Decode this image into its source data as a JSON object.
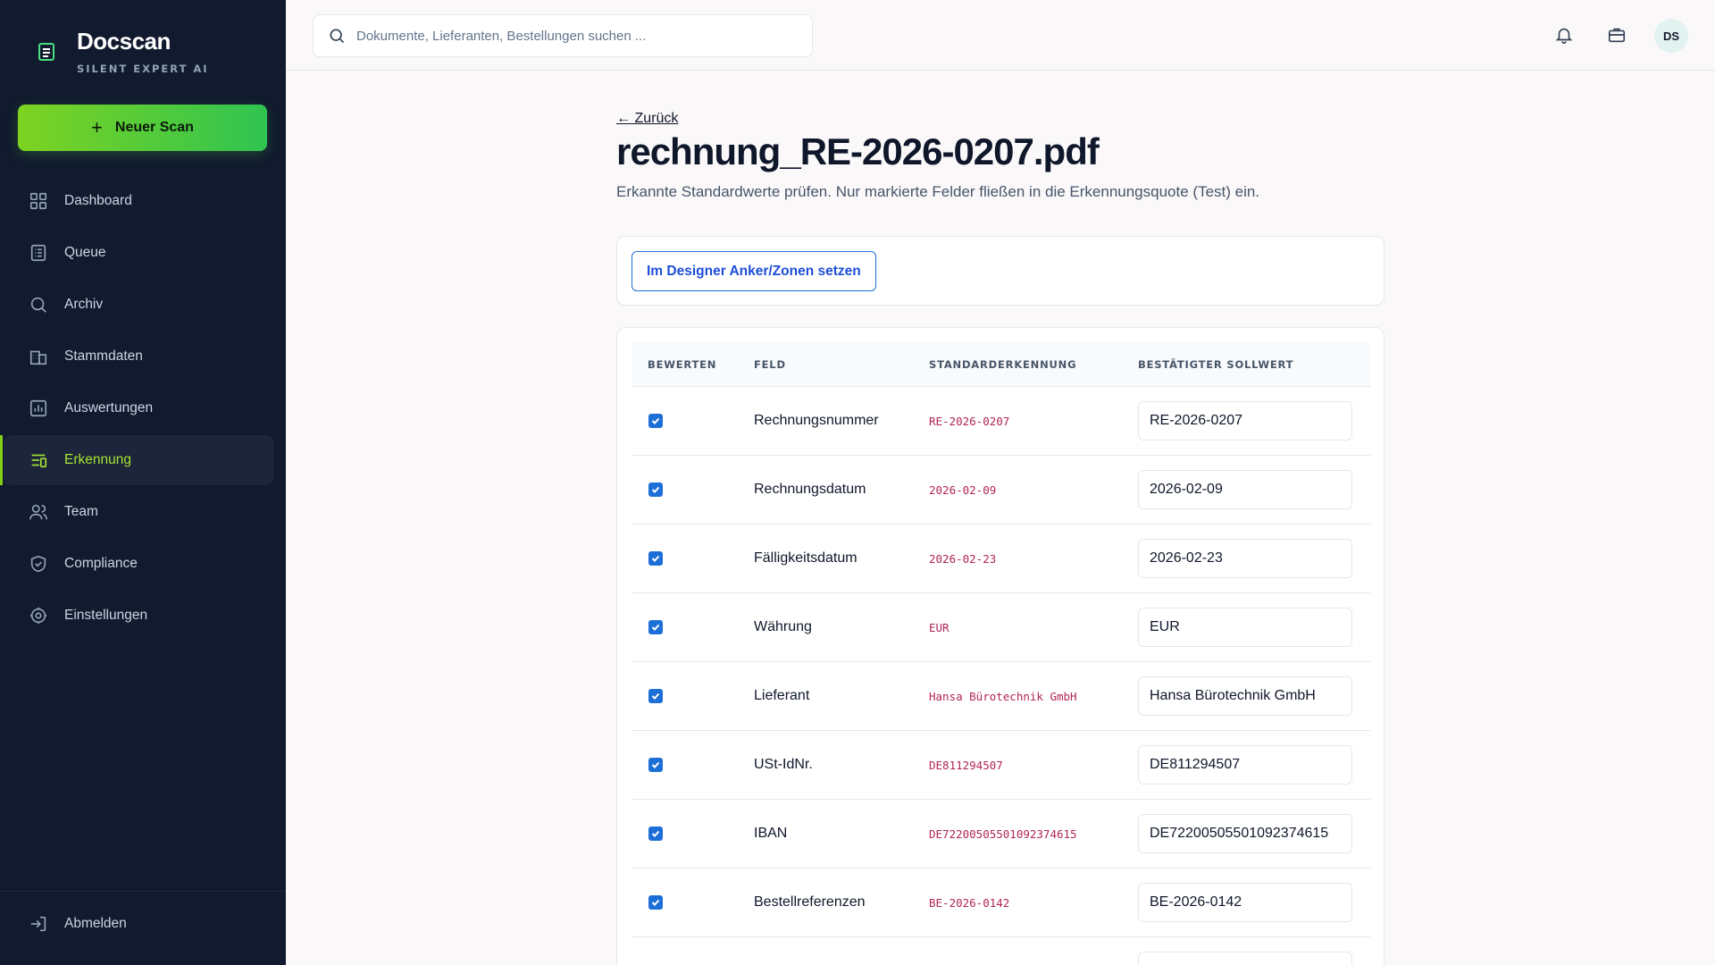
{
  "app": {
    "name": "Docscan",
    "tagline": "SILENT EXPERT AI",
    "new_scan_label": "Neuer Scan",
    "accent_color": "#84cc16"
  },
  "sidebar": {
    "items": [
      {
        "label": "Dashboard",
        "icon": "grid-icon",
        "active": false
      },
      {
        "label": "Queue",
        "icon": "list-icon",
        "active": false
      },
      {
        "label": "Archiv",
        "icon": "search-icon",
        "active": false
      },
      {
        "label": "Stammdaten",
        "icon": "building-icon",
        "active": false
      },
      {
        "label": "Auswertungen",
        "icon": "chart-icon",
        "active": false
      },
      {
        "label": "Erkennung",
        "icon": "filter-lines-icon",
        "active": true
      },
      {
        "label": "Team",
        "icon": "users-icon",
        "active": false
      },
      {
        "label": "Compliance",
        "icon": "shield-icon",
        "active": false
      },
      {
        "label": "Einstellungen",
        "icon": "gear-icon",
        "active": false
      }
    ],
    "logout_label": "Abmelden"
  },
  "topbar": {
    "search_placeholder": "Dokumente, Lieferanten, Bestellungen suchen ...",
    "avatar_initials": "DS"
  },
  "page": {
    "back_label": "← Zurück",
    "title": "rechnung_RE-2026-0207.pdf",
    "subtitle": "Erkannte Standardwerte prüfen. Nur markierte Felder fließen in die Erkennungsquote (Test) ein.",
    "designer_button": "Im Designer Anker/Zonen setzen"
  },
  "table": {
    "headers": {
      "bewerten": "BEWERTEN",
      "feld": "FELD",
      "standard": "STANDARDERKENNUNG",
      "soll": "BESTÄTIGTER SOLLWERT"
    },
    "rows": [
      {
        "checked": true,
        "field": "Rechnungsnummer",
        "detected": "RE-2026-0207",
        "confirmed": "RE-2026-0207"
      },
      {
        "checked": true,
        "field": "Rechnungsdatum",
        "detected": "2026-02-09",
        "confirmed": "2026-02-09"
      },
      {
        "checked": true,
        "field": "Fälligkeitsdatum",
        "detected": "2026-02-23",
        "confirmed": "2026-02-23"
      },
      {
        "checked": true,
        "field": "Währung",
        "detected": "EUR",
        "confirmed": "EUR"
      },
      {
        "checked": true,
        "field": "Lieferant",
        "detected": "Hansa Bürotechnik GmbH",
        "confirmed": "Hansa Bürotechnik GmbH"
      },
      {
        "checked": true,
        "field": "USt-IdNr.",
        "detected": "DE811294507",
        "confirmed": "DE811294507"
      },
      {
        "checked": true,
        "field": "IBAN",
        "detected": "DE72200505501092374615",
        "confirmed": "DE72200505501092374615"
      },
      {
        "checked": true,
        "field": "Bestellreferenzen",
        "detected": "BE-2026-0142",
        "confirmed": "BE-2026-0142"
      }
    ]
  }
}
